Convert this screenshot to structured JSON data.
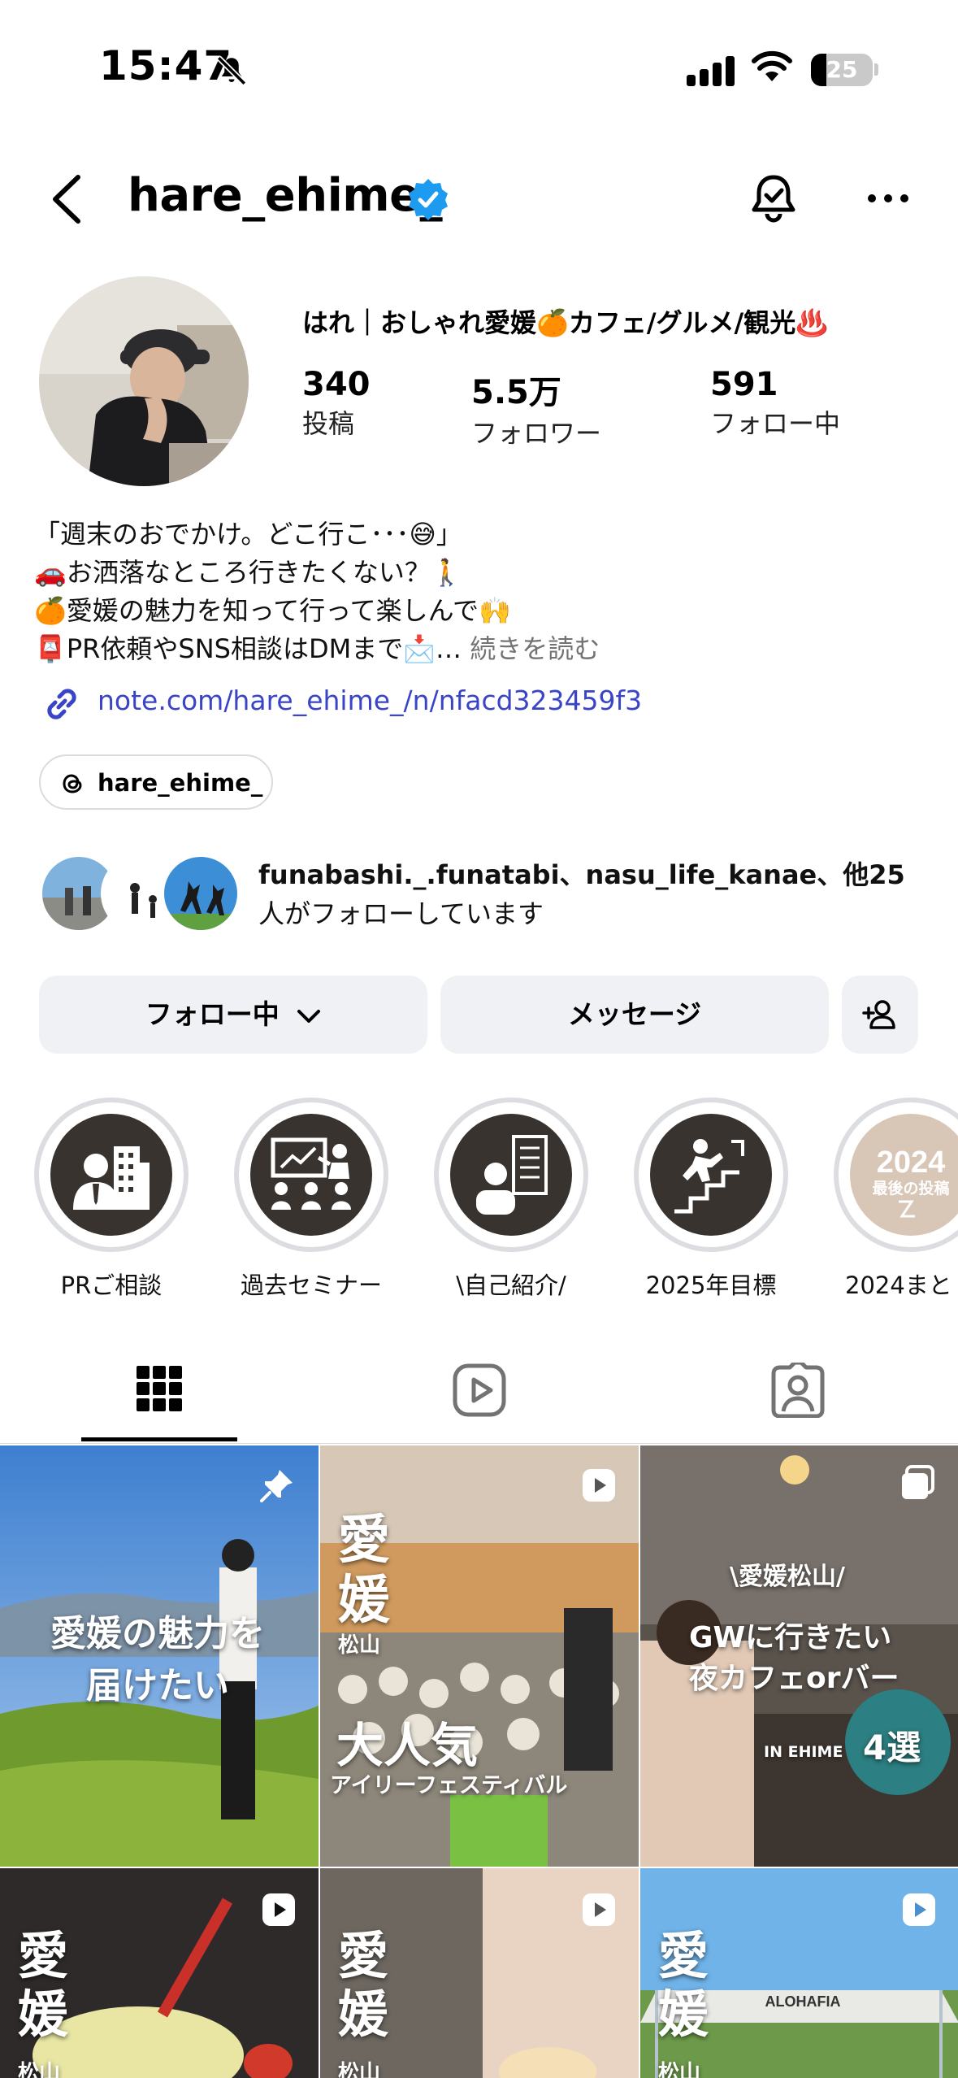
{
  "status_bar": {
    "time": "15:47",
    "battery": "25"
  },
  "header": {
    "username": "hare_ehime_"
  },
  "profile": {
    "display_name": "はれ｜おしゃれ愛媛🍊カフェ/グルメ/観光♨️",
    "stats": [
      {
        "value": "340",
        "label": "投稿"
      },
      {
        "value": "5.5万",
        "label": "フォロワー"
      },
      {
        "value": "591",
        "label": "フォロー中"
      }
    ],
    "bio_lines": [
      "「週末のおでかけ。どこ行こ･･･😅」",
      "🚗お洒落なところ行きたくない？🚶",
      "🍊愛媛の魅力を知って行って楽しんで🙌",
      "📮PR依頼やSNS相談はDMまで📩…"
    ],
    "more_label": "続きを読む",
    "link": "note.com/hare_ehime_/n/nfacd323459f3",
    "threads_handle": "hare_ehime_",
    "followed_by_names": "funabashi._.funatabi、nasu_life_kanae、他25",
    "followed_by_suffix": "人がフォローしています"
  },
  "actions": {
    "following": "フォロー中",
    "message": "メッセージ"
  },
  "highlights": [
    {
      "label": "PRご相談",
      "icon": "business-person-icon"
    },
    {
      "label": "過去セミナー",
      "icon": "seminar-icon"
    },
    {
      "label": "\\自己紹介/",
      "icon": "profile-card-icon"
    },
    {
      "label": "2025年目標",
      "icon": "stairs-climb-icon"
    },
    {
      "label": "2024まと",
      "icon": "year-summary-icon",
      "cover_text": "2024",
      "cover_sub": "最後の投稿"
    }
  ],
  "grid": [
    {
      "overlay": [
        "愛媛の魅力を",
        "届けたい"
      ],
      "badge": "pin-icon"
    },
    {
      "overlay_big": [
        "愛",
        "媛"
      ],
      "sub": "松山",
      "title": "大人気",
      "caption": "アイリーフェスティバル",
      "badge": "reel-icon"
    },
    {
      "overlay_top": "\\愛媛松山/",
      "overlay": [
        "GWに行きたい",
        "夜カフェorバー"
      ],
      "tag": "IN EHIME",
      "circle": "4選",
      "badge": "carousel-icon"
    },
    {
      "overlay_big": [
        "愛",
        "媛"
      ],
      "sub": "松山",
      "badge": "reel-icon"
    },
    {
      "overlay_big": [
        "愛",
        "媛"
      ],
      "sub": "松山",
      "badge": "reel-icon"
    },
    {
      "overlay_big": [
        "愛",
        "媛"
      ],
      "sub": "松山",
      "sign": "ALOHAFIA",
      "badge": "reel-icon"
    }
  ],
  "colors": {
    "link": "#3944c7",
    "verified": "#1d9bf0",
    "button_bg": "#eff1f4",
    "highlight_bg": "#38332f"
  }
}
